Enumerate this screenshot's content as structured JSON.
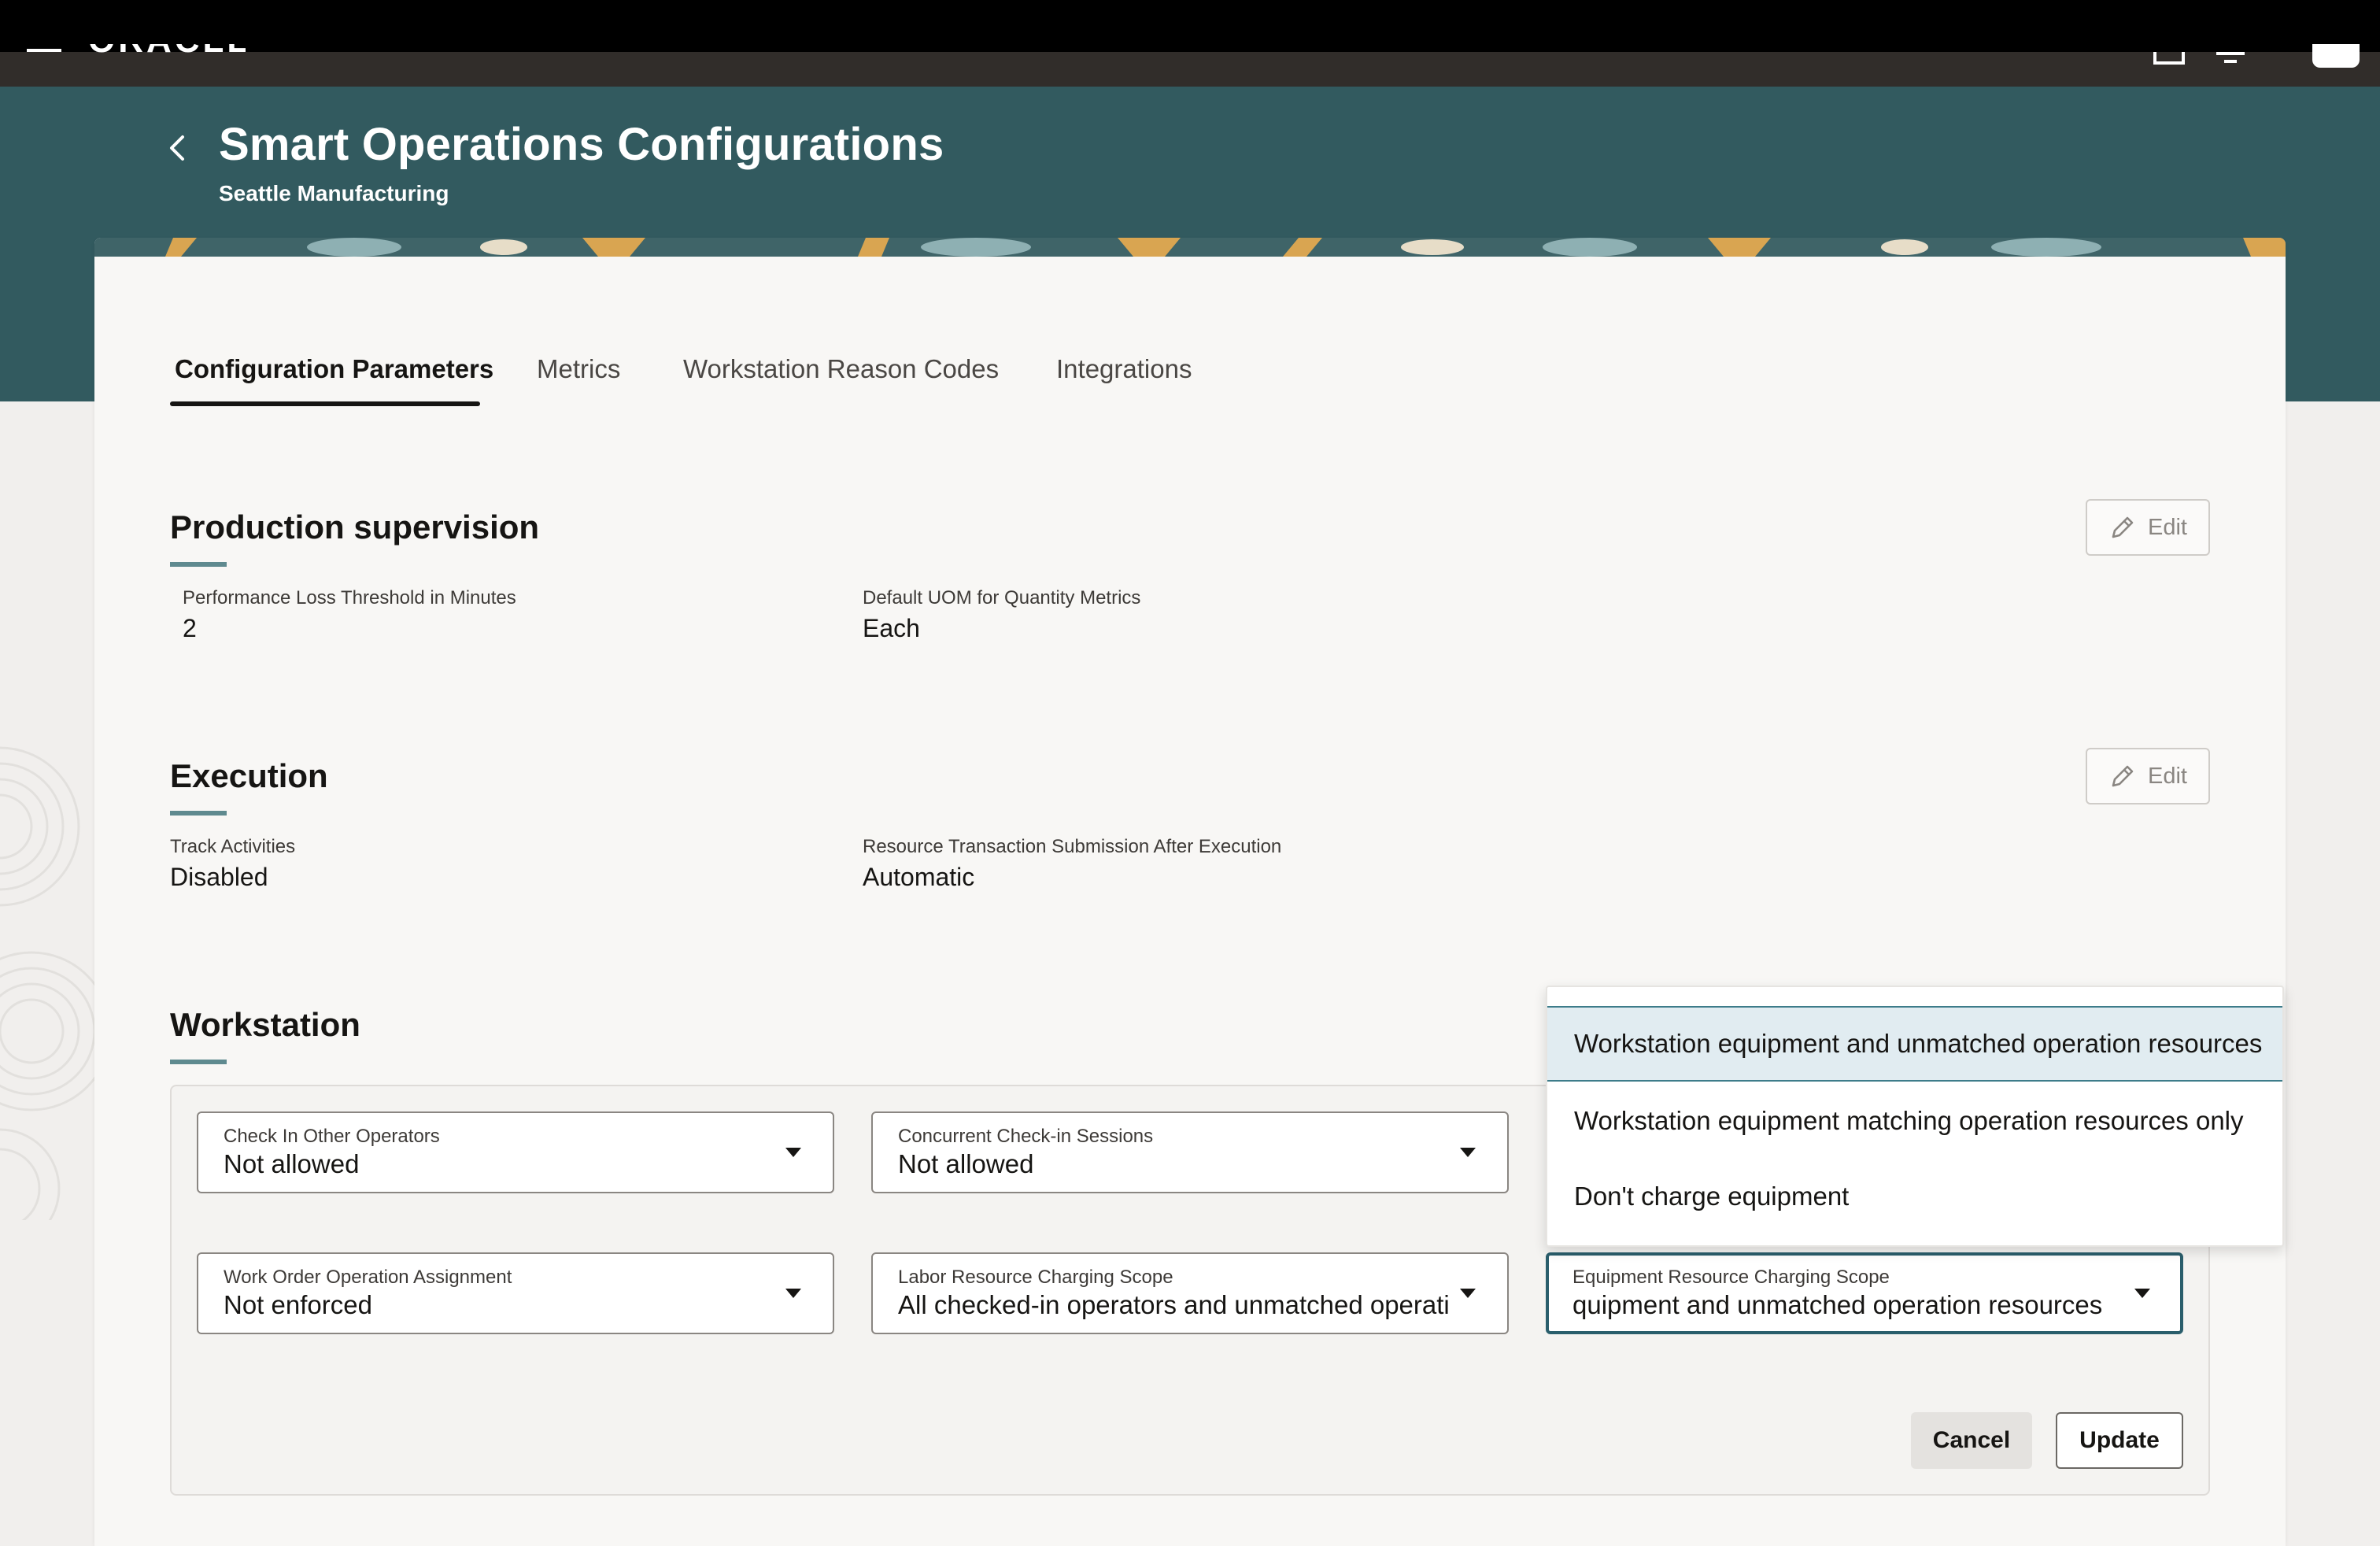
{
  "header": {
    "logo_text": "ORACLE"
  },
  "page": {
    "title": "Smart Operations Configurations",
    "subtitle": "Seattle Manufacturing"
  },
  "tabs": [
    {
      "label": "Configuration Parameters",
      "active": true
    },
    {
      "label": "Metrics",
      "active": false
    },
    {
      "label": "Workstation Reason Codes",
      "active": false
    },
    {
      "label": "Integrations",
      "active": false
    }
  ],
  "production_supervision": {
    "title": "Production supervision",
    "edit_label": "Edit",
    "fields": [
      {
        "label": "Performance Loss Threshold in Minutes",
        "value": "2"
      },
      {
        "label": "Default UOM for Quantity Metrics",
        "value": "Each"
      }
    ]
  },
  "execution": {
    "title": "Execution",
    "edit_label": "Edit",
    "fields": [
      {
        "label": "Track Activities",
        "value": "Disabled"
      },
      {
        "label": "Resource Transaction Submission After Execution",
        "value": "Automatic"
      }
    ]
  },
  "workstation": {
    "title": "Workstation",
    "selects": [
      {
        "label": "Check In Other Operators",
        "value": "Not allowed"
      },
      {
        "label": "Concurrent Check-in Sessions",
        "value": "Not allowed"
      },
      {
        "label": "Work Order Operation Assignment",
        "value": "Not enforced"
      },
      {
        "label": "Labor Resource Charging Scope",
        "value": "All checked-in operators and unmatched operation resources"
      },
      {
        "label": "Equipment Resource Charging Scope",
        "value": "quipment and unmatched operation resources"
      }
    ],
    "cancel_label": "Cancel",
    "update_label": "Update"
  },
  "dropdown": {
    "options": [
      {
        "label": "Workstation equipment and unmatched operation resources",
        "selected": true
      },
      {
        "label": "Workstation equipment matching operation resources only",
        "selected": false
      },
      {
        "label": "Don't charge equipment",
        "selected": false
      }
    ]
  },
  "colors": {
    "header_teal": "#325a5f",
    "brand_bar": "#312d2a",
    "accent_rule": "#5f8a8f",
    "focus_border": "#2a5e6c",
    "selected_option_bg": "#e1ecf1"
  },
  "icons": {
    "back": "chevron-left-icon",
    "edit": "pencil-icon",
    "select_caret": "caret-down-icon"
  }
}
